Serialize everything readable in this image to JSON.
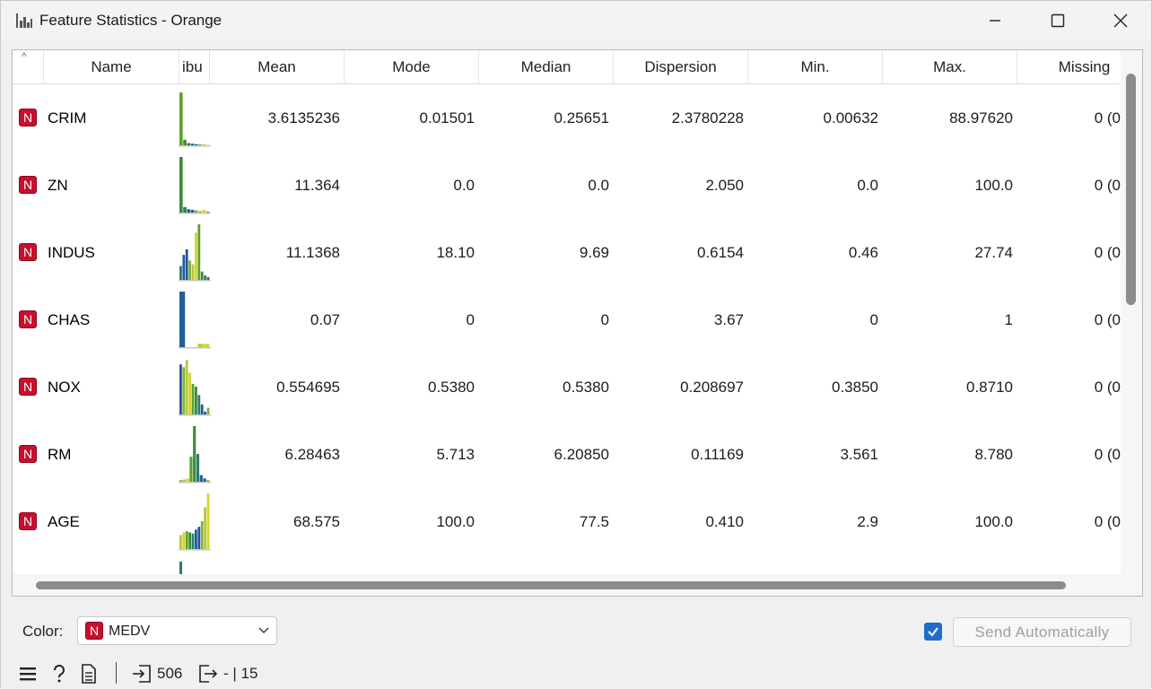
{
  "window": {
    "title": "Feature Statistics - Orange",
    "icon": "bar-chart-icon",
    "minimize": "minimize-icon",
    "maximize": "maximize-icon",
    "close": "close-icon"
  },
  "table": {
    "headers": [
      "Name",
      "ibu",
      "Mean",
      "Mode",
      "Median",
      "Dispersion",
      "Min.",
      "Max.",
      "Missing"
    ],
    "sort_indicator": "^",
    "rows": [
      {
        "type": "N",
        "name": "CRIM",
        "mean": "3.6135236",
        "mode": "0.01501",
        "median": "0.25651",
        "dispersion": "2.3780228",
        "min": "0.00632",
        "max": "88.97620",
        "missing": "0 (0"
      },
      {
        "type": "N",
        "name": "ZN",
        "mean": "11.364",
        "mode": "0.0",
        "median": "0.0",
        "dispersion": "2.050",
        "min": "0.0",
        "max": "100.0",
        "missing": "0 (0"
      },
      {
        "type": "N",
        "name": "INDUS",
        "mean": "11.1368",
        "mode": "18.10",
        "median": "9.69",
        "dispersion": "0.6154",
        "min": "0.46",
        "max": "27.74",
        "missing": "0 (0"
      },
      {
        "type": "N",
        "name": "CHAS",
        "mean": "0.07",
        "mode": "0",
        "median": "0",
        "dispersion": "3.67",
        "min": "0",
        "max": "1",
        "missing": "0 (0"
      },
      {
        "type": "N",
        "name": "NOX",
        "mean": "0.554695",
        "mode": "0.5380",
        "median": "0.5380",
        "dispersion": "0.208697",
        "min": "0.3850",
        "max": "0.8710",
        "missing": "0 (0"
      },
      {
        "type": "N",
        "name": "RM",
        "mean": "6.28463",
        "mode": "5.713",
        "median": "6.20850",
        "dispersion": "0.11169",
        "min": "3.561",
        "max": "8.780",
        "missing": "0 (0"
      },
      {
        "type": "N",
        "name": "AGE",
        "mean": "68.575",
        "mode": "100.0",
        "median": "77.5",
        "dispersion": "0.410",
        "min": "2.9",
        "max": "100.0",
        "missing": "0 (0"
      }
    ]
  },
  "histograms": {
    "CRIM": [
      0.95,
      0.1,
      0.04,
      0.03,
      0.02,
      0.02,
      0.02,
      0.01
    ],
    "ZN": [
      1.0,
      0.1,
      0.06,
      0.05,
      0.04,
      0.03,
      0.05,
      0.02
    ],
    "INDUS": [
      0.25,
      0.45,
      0.55,
      0.35,
      0.28,
      0.85,
      1.0,
      0.15,
      0.08,
      0.05
    ],
    "CHAS": [
      1.0,
      0.0,
      0.0,
      0.06,
      0.06
    ],
    "NOX": [
      0.9,
      0.85,
      0.98,
      0.75,
      0.55,
      0.5,
      0.35,
      0.18,
      0.05,
      0.12
    ],
    "RM": [
      0.03,
      0.04,
      0.06,
      0.45,
      1.0,
      0.5,
      0.12,
      0.06,
      0.03
    ],
    "AGE": [
      0.25,
      0.3,
      0.32,
      0.3,
      0.28,
      0.35,
      0.4,
      0.5,
      0.75,
      1.0
    ],
    "next": [
      0.2
    ]
  },
  "hist_colors": [
    "#5aa32a",
    "#3d8c3a",
    "#2e7d6b",
    "#1f5f9b",
    "#2b4fa3",
    "#7ab23b",
    "#b5c934",
    "#d6d234"
  ],
  "footer": {
    "color_label": "Color:",
    "color_value": "MEDV",
    "color_value_type": "N",
    "send_label": "Send Automatically",
    "send_checked": true,
    "input_count": "506",
    "output_count": "- | 15",
    "icons": [
      "menu-icon",
      "help-icon",
      "report-icon",
      "input-icon",
      "output-icon"
    ]
  },
  "colors": {
    "accent": "#1f6cc9",
    "numeric_badge": "#c8102e"
  }
}
